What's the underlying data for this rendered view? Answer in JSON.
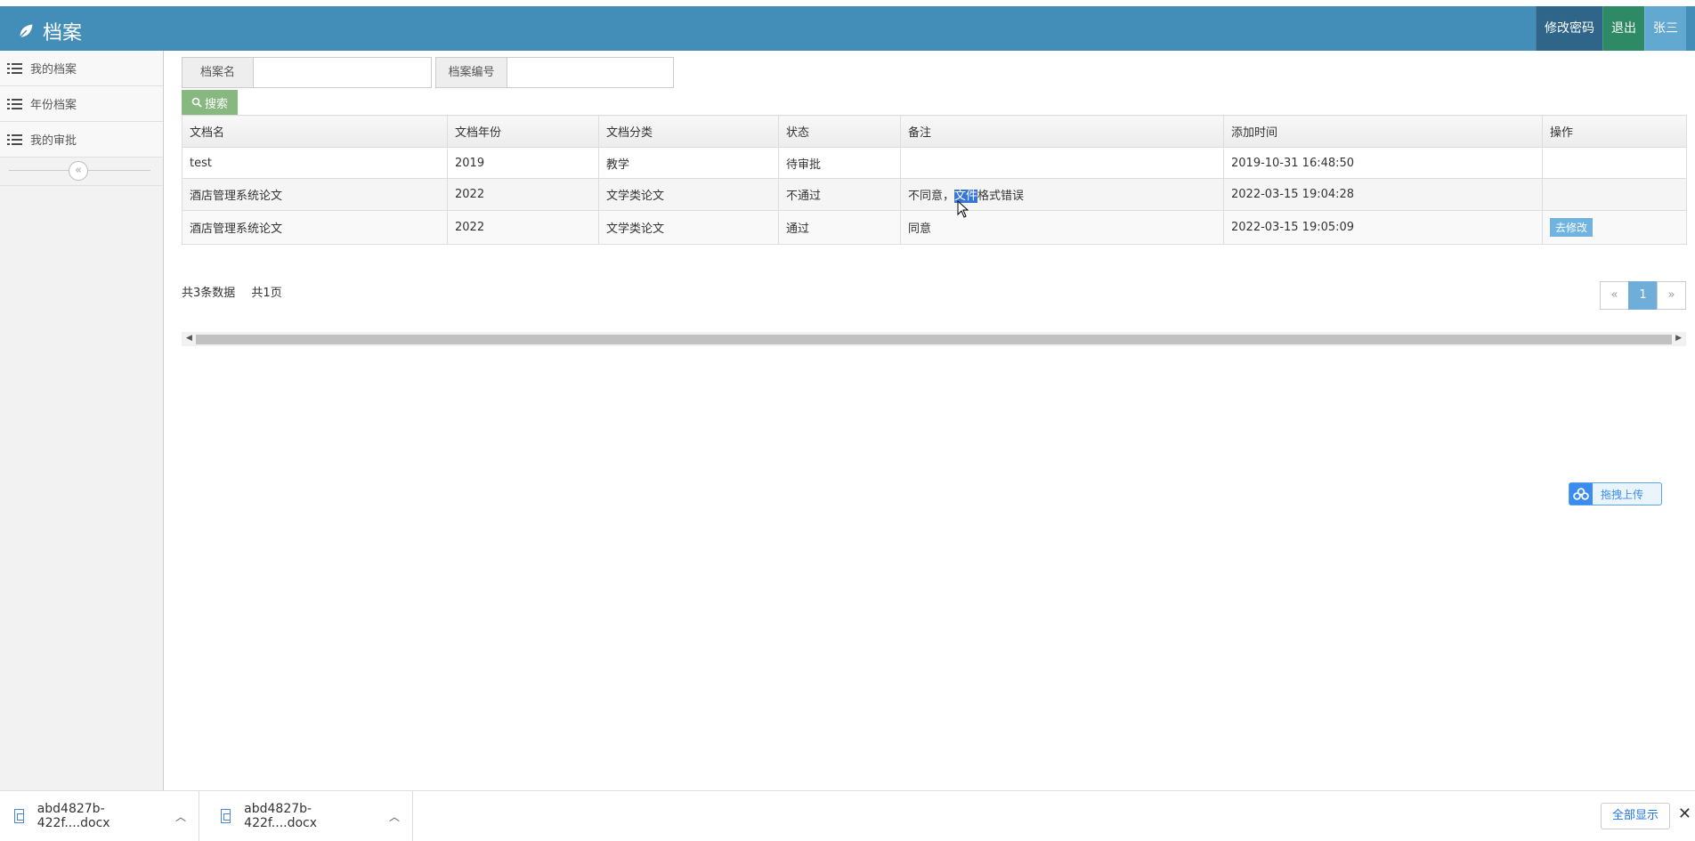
{
  "header": {
    "title": "档案",
    "buttons": {
      "change_password": "修改密码",
      "logout": "退出",
      "user": "张三"
    }
  },
  "sidebar": {
    "items": [
      {
        "label": "我的档案"
      },
      {
        "label": "年份档案"
      },
      {
        "label": "我的审批"
      }
    ],
    "collapse_glyph": "«"
  },
  "search": {
    "name_label": "档案名",
    "name_value": "",
    "number_label": "档案编号",
    "number_value": "",
    "button_label": "搜索"
  },
  "table": {
    "headers": [
      "文档名",
      "文档年份",
      "文档分类",
      "状态",
      "备注",
      "添加时间",
      "操作"
    ],
    "rows": [
      {
        "name": "test",
        "year": "2019",
        "category": "教学",
        "status": "待审批",
        "remark": "",
        "time": "2019-10-31 16:48:50",
        "action": ""
      },
      {
        "name": "酒店管理系统论文",
        "year": "2022",
        "category": "文学类论文",
        "status": "不通过",
        "remark_pre": "不同意，",
        "remark_sel": "文件",
        "remark_post": "格式错误",
        "time": "2022-03-15 19:04:28",
        "action": ""
      },
      {
        "name": "酒店管理系统论文",
        "year": "2022",
        "category": "文学类论文",
        "status": "通过",
        "remark": "同意",
        "time": "2022-03-15 19:05:09",
        "action": "去修改"
      }
    ]
  },
  "summary": {
    "total_records": "共3条数据",
    "total_pages": "共1页"
  },
  "pagination": {
    "prev": "«",
    "current": "1",
    "next": "»"
  },
  "upload": {
    "label": "拖拽上传"
  },
  "downloads": {
    "items": [
      {
        "filename": "abd4827b-422f....docx"
      },
      {
        "filename": "abd4827b-422f....docx"
      }
    ],
    "show_all": "全部显示",
    "close": "✕"
  }
}
